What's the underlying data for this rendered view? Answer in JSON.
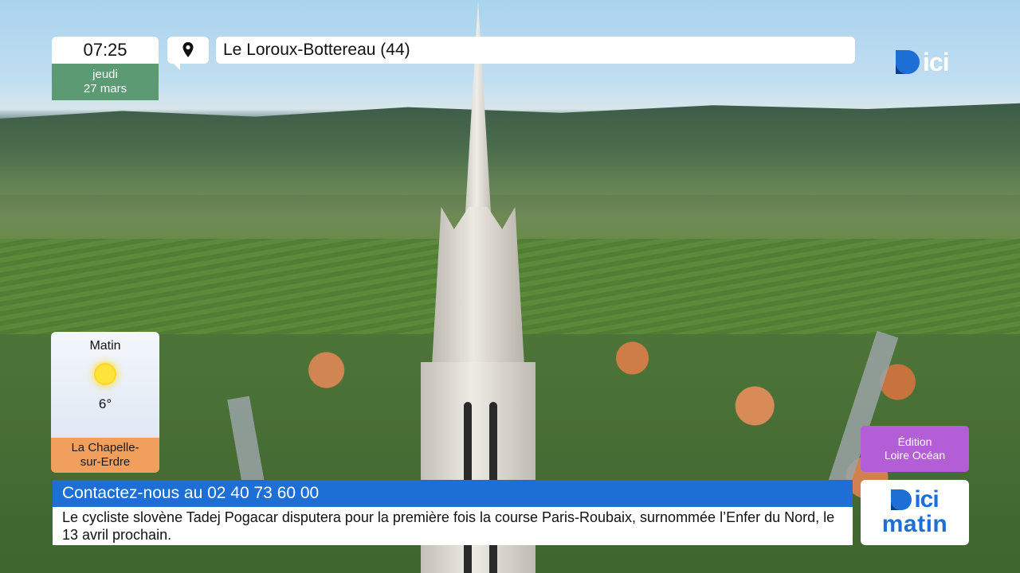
{
  "clock": {
    "time": "07:25",
    "day": "jeudi",
    "date": "27 mars"
  },
  "location": {
    "icon": "map-pin-icon",
    "name": "Le Loroux-Bottereau (44)"
  },
  "logo": {
    "text": "ici"
  },
  "weather": {
    "period": "Matin",
    "icon": "sun-icon",
    "temperature": "6°",
    "city_line1": "La Chapelle-",
    "city_line2": "sur-Erdre"
  },
  "edition": {
    "line1": "Édition",
    "line2": "Loire Océan"
  },
  "ticker": {
    "contact": "Contactez-nous au 02 40 73 60 00",
    "news": "Le cycliste slovène Tadej Pogacar disputera pour la première fois la course Paris-Roubaix, surnommée l’Enfer du Nord, le 13 avril prochain."
  },
  "brand": {
    "top": "ici",
    "bottom": "matin"
  },
  "colors": {
    "accent_blue": "#1d6fd6",
    "clock_green": "#5b9a72",
    "city_orange": "#f0a05c",
    "edition_purple": "#b35ed6"
  }
}
